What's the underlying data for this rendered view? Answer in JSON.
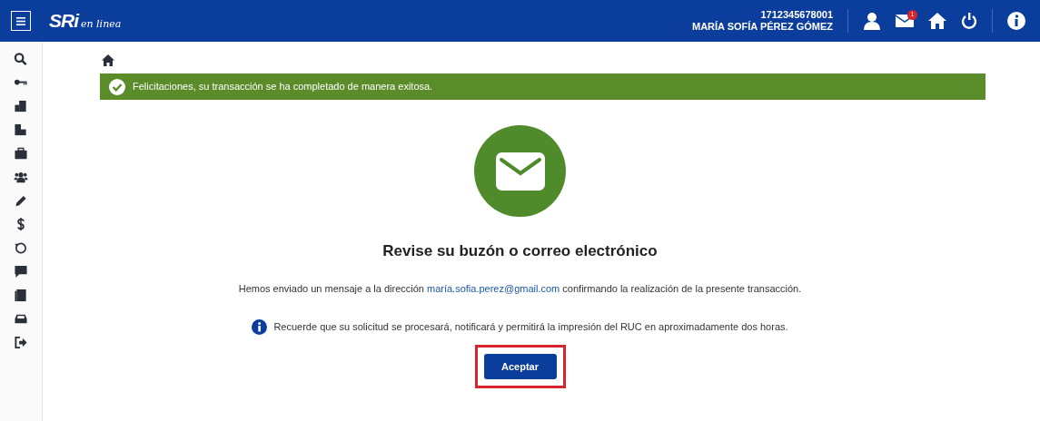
{
  "header": {
    "logo_main": "SRi",
    "logo_sub": "en linea",
    "user_id": "1712345678001",
    "user_name": "MARÍA SOFÍA PÉREZ GÓMEZ",
    "mail_badge": "1"
  },
  "alert": {
    "text": "Felicitaciones, su transacción se ha completado de manera exitosa."
  },
  "heading": "Revise su buzón o correo electrónico",
  "message": {
    "before": "Hemos enviado un mensaje a la dirección",
    "link": "maría.sofia.perez@gmail.com",
    "after": "confirmando la realización de la presente transacción."
  },
  "note": "Recuerde que su solicitud se procesará, notificará y permitirá la impresión del RUC en aproximadamente dos horas.",
  "button": {
    "label": "Aceptar",
    "highlighted": true
  }
}
